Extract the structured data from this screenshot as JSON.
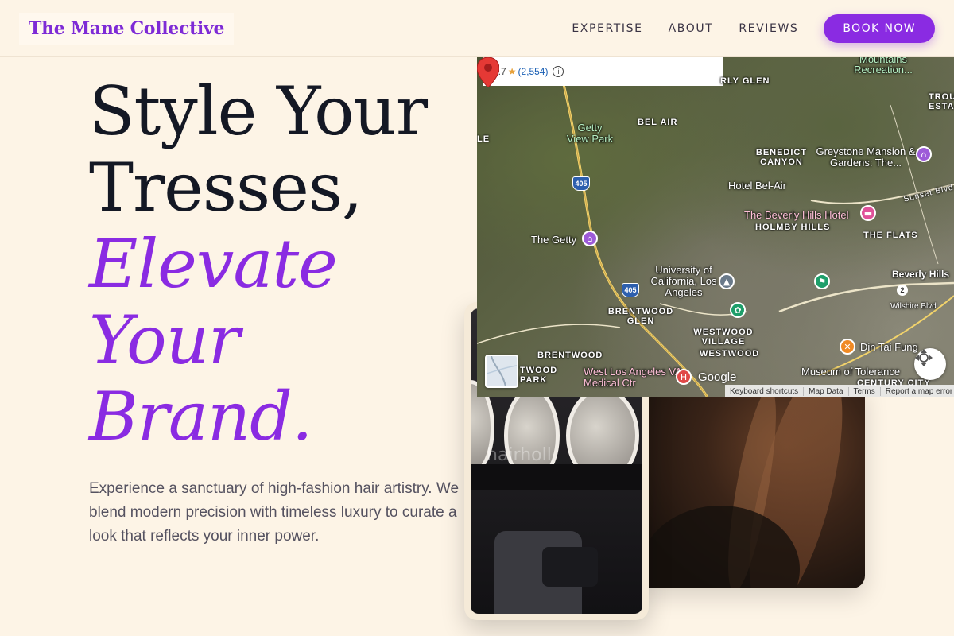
{
  "header": {
    "logo": "The Mane Collective",
    "nav": [
      "EXPERTISE",
      "ABOUT",
      "REVIEWS"
    ],
    "cta": "BOOK NOW"
  },
  "hero": {
    "line1": "Style Your",
    "line2": "Tresses,",
    "line3": "Elevate",
    "line4": "Your",
    "line5": "Brand.",
    "description": "Experience a sanctuary of high-fashion hair artistry. We blend modern precision with timeless luxury to curate a look that reflects your inner power.",
    "accent_color": "#8a2be2"
  },
  "images": {
    "salon_watermark": "hairholl"
  },
  "map": {
    "rating": "4.7",
    "review_count": "(2,554)",
    "labels": {
      "bel_air": "BEL AIR",
      "bel_air_top": "RLY GLEN",
      "benedict": "BENEDICT CANYON",
      "holmby": "HOLMBY HILLS",
      "the_flats": "THE FLATS",
      "brentwood_glen": "BRENTWOOD GLEN",
      "westwood_village": "WESTWOOD VILLAGE",
      "westwood": "WESTWOOD",
      "brentwood": "BRENTWOOD",
      "brentwood_park": "TWOOD PARK",
      "century_city": "CENTURY CITY",
      "trous": "TROUS ESTA",
      "sunset": "Sunset Blvd",
      "wilshire": "Wilshire Blvd",
      "beverly_hills": "Beverly Hills",
      "left_edge": "LE"
    },
    "pois": {
      "mountains": "Mountains Recreation...",
      "getty_view": "Getty View Park",
      "greystone": "Greystone Mansion & Gardens: The...",
      "hotel_bel_air": "Hotel Bel-Air",
      "beverly_hotel": "The Beverly Hills Hotel",
      "getty": "The Getty",
      "ucla": "University of California, Los Angeles",
      "din_tai": "Din Tai Fung",
      "va": "West Los Angeles VA Medical Ctr",
      "museum": "Museum of Tolerance"
    },
    "shields": [
      "405",
      "405",
      "2"
    ],
    "google": "Google",
    "attribution": [
      "Keyboard shortcuts",
      "Map Data",
      "Terms",
      "Report a map error"
    ]
  }
}
